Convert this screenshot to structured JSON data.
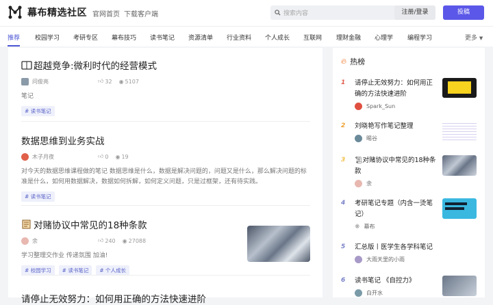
{
  "header": {
    "site_name": "幕布精选社区",
    "links": [
      "官网首页",
      "下载客户端"
    ],
    "search_placeholder": "搜索内容",
    "login_label": "注册/登录",
    "submit_label": "投稿"
  },
  "nav": {
    "items": [
      "推荐",
      "校园学习",
      "考研专区",
      "幕布技巧",
      "读书笔记",
      "资源清单",
      "行业资料",
      "个人成长",
      "互联网",
      "理财金融",
      "心理学",
      "编程学习"
    ],
    "active": "推荐",
    "more_label": "更多"
  },
  "articles": [
    {
      "title": "超越竞争:微利时代的经营模式",
      "author": "问俊亮",
      "likes": "32",
      "views": "5107",
      "desc": "笔记",
      "tags": [
        "# 读书笔记"
      ]
    },
    {
      "title": "数据思维到业务实战",
      "author": "木子月夜",
      "likes": "0",
      "views": "19",
      "desc": "对今天的数据思维课程做的笔记 数据思维是什么，数据是解决问题的，问题又是什么，那么解决问题的标准是什么，如何用数据解决，数据如何拆解，如何定义问题，只是过框架，还有待实践。",
      "tags": [
        "# 读书笔记"
      ]
    },
    {
      "title": "对赌协议中常见的18种条款",
      "author": "余",
      "likes": "240",
      "views": "27088",
      "desc": "学习整理交作业 传递氛围 加油!",
      "tags": [
        "# 校园学习",
        "# 读书笔记",
        "# 个人成长"
      ]
    },
    {
      "title": "请停止无效努力：如何用正确的方法快速进阶"
    }
  ],
  "sidebar": {
    "heading": "热榜",
    "items": [
      {
        "num": "1",
        "title": "请停止无效努力：如何用正确的方法快速进阶",
        "author": "Spark_Sun",
        "num_color": "#e05a4a"
      },
      {
        "num": "2",
        "title": "刘晓艳写作笔记整理",
        "author": "晹谷",
        "num_color": "#f0a030"
      },
      {
        "num": "3",
        "title": "对赌协议中常见的18种条款",
        "author": "余",
        "num_color": "#f2c14a"
      },
      {
        "num": "4",
        "title": "考研笔记专题（内含一烫笔记）",
        "author": "幕布",
        "num_color": "#7a83c8"
      },
      {
        "num": "5",
        "title": "汇总版丨医学生各学科笔记",
        "author": "大雨天里的小雨",
        "num_color": "#7a83c8"
      },
      {
        "num": "6",
        "title": "读书笔记 《自控力》",
        "author": "白开水",
        "num_color": "#7a83c8"
      }
    ]
  },
  "colors": {
    "accent": "#5b57e8",
    "active_nav": "#4a55d4",
    "tag_text": "#5a63c8"
  }
}
